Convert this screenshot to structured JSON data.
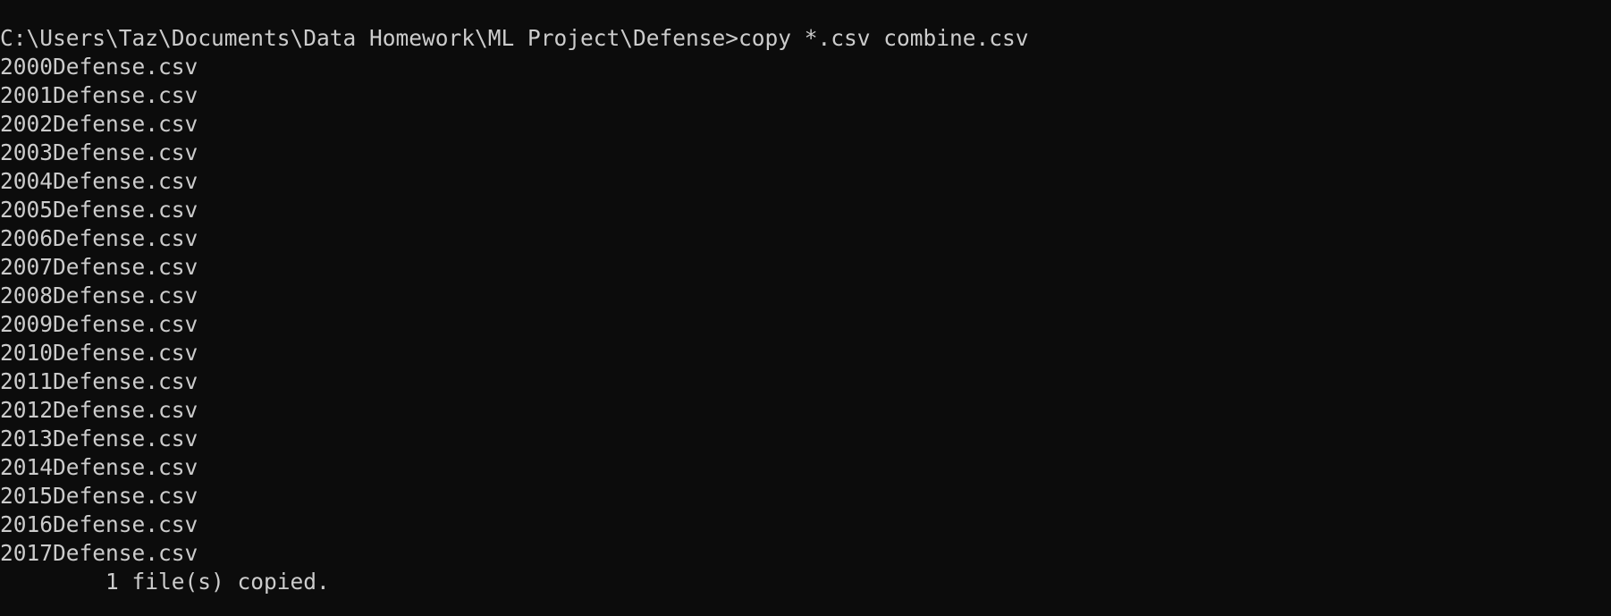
{
  "terminal": {
    "prompt_line": "C:\\Users\\Taz\\Documents\\Data Homework\\ML Project\\Defense>copy *.csv combine.csv",
    "files": [
      "2000Defense.csv",
      "2001Defense.csv",
      "2002Defense.csv",
      "2003Defense.csv",
      "2004Defense.csv",
      "2005Defense.csv",
      "2006Defense.csv",
      "2007Defense.csv",
      "2008Defense.csv",
      "2009Defense.csv",
      "2010Defense.csv",
      "2011Defense.csv",
      "2012Defense.csv",
      "2013Defense.csv",
      "2014Defense.csv",
      "2015Defense.csv",
      "2016Defense.csv",
      "2017Defense.csv"
    ],
    "summary": "        1 file(s) copied."
  },
  "colors": {
    "background": "#0c0c0c",
    "foreground": "#cccccc"
  }
}
